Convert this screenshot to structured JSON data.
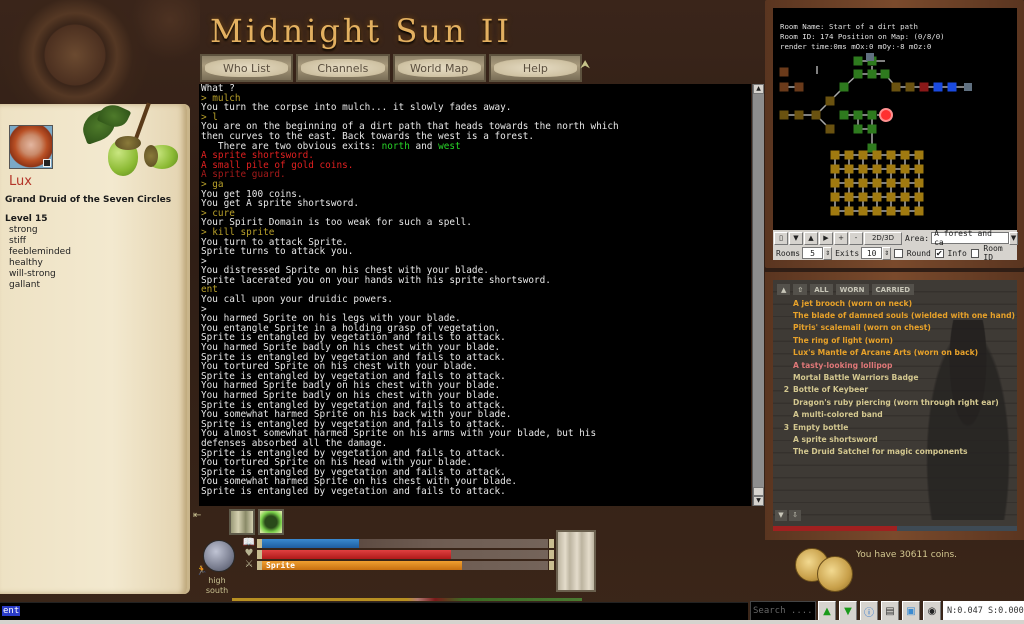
{
  "app": {
    "title": "Midnight Sun II"
  },
  "nav": {
    "buttons": [
      {
        "label": "Who List"
      },
      {
        "label": "Channels"
      },
      {
        "label": "World Map"
      },
      {
        "label": "Help"
      }
    ]
  },
  "character": {
    "name": "Lux",
    "title": "Grand Druid of the Seven Circles",
    "level": "Level 15",
    "attributes": [
      "strong",
      "stiff",
      "feebleminded",
      "healthy",
      "will-strong",
      "gallant"
    ]
  },
  "console": {
    "lines": [
      {
        "t": "What ?",
        "c": ""
      },
      {
        "t": "> mulch",
        "c": "cmd"
      },
      {
        "t": "You turn the corpse into mulch... it slowly fades away.",
        "c": ""
      },
      {
        "t": "> l",
        "c": "cmd"
      },
      {
        "t": "You are on the beginning of a dirt path that heads towards the north which",
        "c": ""
      },
      {
        "t": "then curves to the east. Back towards the west is a forest.",
        "c": ""
      },
      {
        "t": "EXITS",
        "c": "exits"
      },
      {
        "t": "A sprite shortsword.",
        "c": "red"
      },
      {
        "t": "A small pile of gold coins.",
        "c": "red"
      },
      {
        "t": "A sprite guard.",
        "c": "dred"
      },
      {
        "t": "> ga",
        "c": "cmd"
      },
      {
        "t": "You get 100 coins.",
        "c": ""
      },
      {
        "t": "You get A sprite shortsword.",
        "c": ""
      },
      {
        "t": "> cure",
        "c": "cmd"
      },
      {
        "t": "Your Spirit Domain is too weak for such a spell.",
        "c": ""
      },
      {
        "t": "> kill sprite",
        "c": "cmd"
      },
      {
        "t": "You turn to attack Sprite.",
        "c": ""
      },
      {
        "t": "Sprite turns to attack you.",
        "c": ""
      },
      {
        "t": ">",
        "c": ""
      },
      {
        "t": "You distressed Sprite on his chest with your blade.",
        "c": ""
      },
      {
        "t": "Sprite lacerated you on your hands with his sprite shortsword.",
        "c": ""
      },
      {
        "t": "ent",
        "c": "cmd"
      },
      {
        "t": "You call upon your druidic powers.",
        "c": ""
      },
      {
        "t": ">",
        "c": ""
      },
      {
        "t": "You harmed Sprite on his legs with your blade.",
        "c": ""
      },
      {
        "t": "You entangle Sprite in a holding grasp of vegetation.",
        "c": ""
      },
      {
        "t": "Sprite is entangled by vegetation and fails to attack.",
        "c": ""
      },
      {
        "t": "You harmed Sprite badly on his chest with your blade.",
        "c": ""
      },
      {
        "t": "Sprite is entangled by vegetation and fails to attack.",
        "c": ""
      },
      {
        "t": "You tortured Sprite on his chest with your blade.",
        "c": ""
      },
      {
        "t": "Sprite is entangled by vegetation and fails to attack.",
        "c": ""
      },
      {
        "t": "You harmed Sprite badly on his chest with your blade.",
        "c": ""
      },
      {
        "t": "You harmed Sprite badly on his chest with your blade.",
        "c": ""
      },
      {
        "t": "Sprite is entangled by vegetation and fails to attack.",
        "c": ""
      },
      {
        "t": "You somewhat harmed Sprite on his back with your blade.",
        "c": ""
      },
      {
        "t": "Sprite is entangled by vegetation and fails to attack.",
        "c": ""
      },
      {
        "t": "You almost somewhat harmed Sprite on his arms with your blade, but his",
        "c": ""
      },
      {
        "t": "defenses absorbed all the damage.",
        "c": ""
      },
      {
        "t": "Sprite is entangled by vegetation and fails to attack.",
        "c": ""
      },
      {
        "t": "You tortured Sprite on his head with your blade.",
        "c": ""
      },
      {
        "t": "Sprite is entangled by vegetation and fails to attack.",
        "c": ""
      },
      {
        "t": "You somewhat harmed Sprite on his chest with your blade.",
        "c": ""
      },
      {
        "t": "Sprite is entangled by vegetation and fails to attack.",
        "c": ""
      }
    ],
    "exits_prefix": "   There are two obvious exits: ",
    "exit1": "north",
    "exits_and": " and ",
    "exit2": "west"
  },
  "map": {
    "room_name": "Room Name: Start of a dirt path",
    "room_id": "Room ID: 174 Position on Map: (0/8/0)",
    "render": "render time:0ms mOx:0 mOy:-8 mOz:0",
    "controls": {
      "btn_2d3d": "2D/3D",
      "area_label": "Area:",
      "area_value": "A forest and ca",
      "rooms_label": "Rooms",
      "rooms_value": "5",
      "exits_label": "Exits",
      "exits_value": "10",
      "round_label": "Round",
      "round_checked": false,
      "info_label": "Info",
      "info_checked": true,
      "roomid_label": "Room ID",
      "roomid_checked": false
    }
  },
  "inventory": {
    "tabs": [
      "ALL",
      "WORN",
      "CARRIED"
    ],
    "items": [
      {
        "qty": "",
        "name": "A jet brooch (worn on neck)",
        "style": "worn"
      },
      {
        "qty": "",
        "name": "The blade of damned souls (wielded with one hand)",
        "style": "worn"
      },
      {
        "qty": "",
        "name": "Pitris' scalemail (worn on chest)",
        "style": "worn"
      },
      {
        "qty": "",
        "name": "The ring of light (worn)",
        "style": "worn"
      },
      {
        "qty": "",
        "name": "Lux's Mantle of Arcane Arts (worn on back)",
        "style": "worn"
      },
      {
        "qty": "",
        "name": "A tasty-looking lollipop",
        "style": "pink"
      },
      {
        "qty": "",
        "name": "Mortal Battle Warriors Badge",
        "style": "plain"
      },
      {
        "qty": "2",
        "name": "Bottle of Keybeer",
        "style": "plain"
      },
      {
        "qty": "",
        "name": "Dragon's ruby piercing (worn through right ear)",
        "style": "plain"
      },
      {
        "qty": "",
        "name": "A multi-colored band",
        "style": "plain"
      },
      {
        "qty": "3",
        "name": "Empty bottle",
        "style": "plain"
      },
      {
        "qty": "",
        "name": "A sprite shortsword",
        "style": "plain"
      },
      {
        "qty": "",
        "name": "The Druid Satchel for magic components",
        "style": "plain"
      }
    ],
    "load_fraction": 0.51
  },
  "coins": {
    "text": "You have 30611 coins."
  },
  "status": {
    "mana_fraction": 0.34,
    "health_fraction": 0.66,
    "target_fraction": 0.7,
    "target_name": "Sprite",
    "orb_line1": "high",
    "orb_line2": "south"
  },
  "command": {
    "value": "ent"
  },
  "toolbar": {
    "search_placeholder": "Search ....",
    "net_status": "N:0.047 S:0.000"
  },
  "colors": {
    "accent_gold": "#e3b060",
    "console_cmd": "#b8a02a",
    "exit_green": "#28d428",
    "item_red": "#e02020",
    "inventory_worn": "#e8a22a"
  }
}
